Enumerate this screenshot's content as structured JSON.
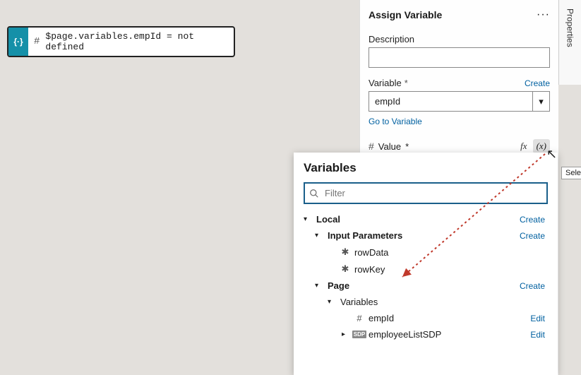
{
  "canvasNode": {
    "accentGlyph": "{·}",
    "hashGlyph": "#",
    "text": "$page.variables.empId = not defined"
  },
  "panel": {
    "title": "Assign Variable",
    "menuGlyph": "···",
    "descriptionLabel": "Description",
    "descriptionValue": "",
    "variableLabel": "Variable",
    "requiredMark": "*",
    "createLink": "Create",
    "variableSelected": "empId",
    "caretGlyph": "▾",
    "goToVariable": "Go to Variable",
    "valueLabel": "Value",
    "hashGlyph": "#",
    "fxGlyph": "fx",
    "varPickerGlyph": "(x)"
  },
  "tooltip": {
    "select": "Select"
  },
  "sideTab": {
    "label": "Properties"
  },
  "varsPopup": {
    "title": "Variables",
    "filterPlaceholder": "Filter",
    "filterValue": "",
    "createAction": "Create",
    "editAction": "Edit",
    "tree": {
      "local": {
        "label": "Local"
      },
      "inputParams": {
        "label": "Input Parameters",
        "items": [
          {
            "name": "rowData",
            "icon": "✱"
          },
          {
            "name": "rowKey",
            "icon": "✱"
          }
        ]
      },
      "page": {
        "label": "Page",
        "variablesLabel": "Variables",
        "items": [
          {
            "name": "empId",
            "icon": "#"
          },
          {
            "name": "employeeListSDP",
            "icon": "SDP"
          }
        ]
      }
    }
  },
  "colors": {
    "accent": "#1590a8",
    "link": "#0060a0",
    "arrow": "#c0392b"
  }
}
